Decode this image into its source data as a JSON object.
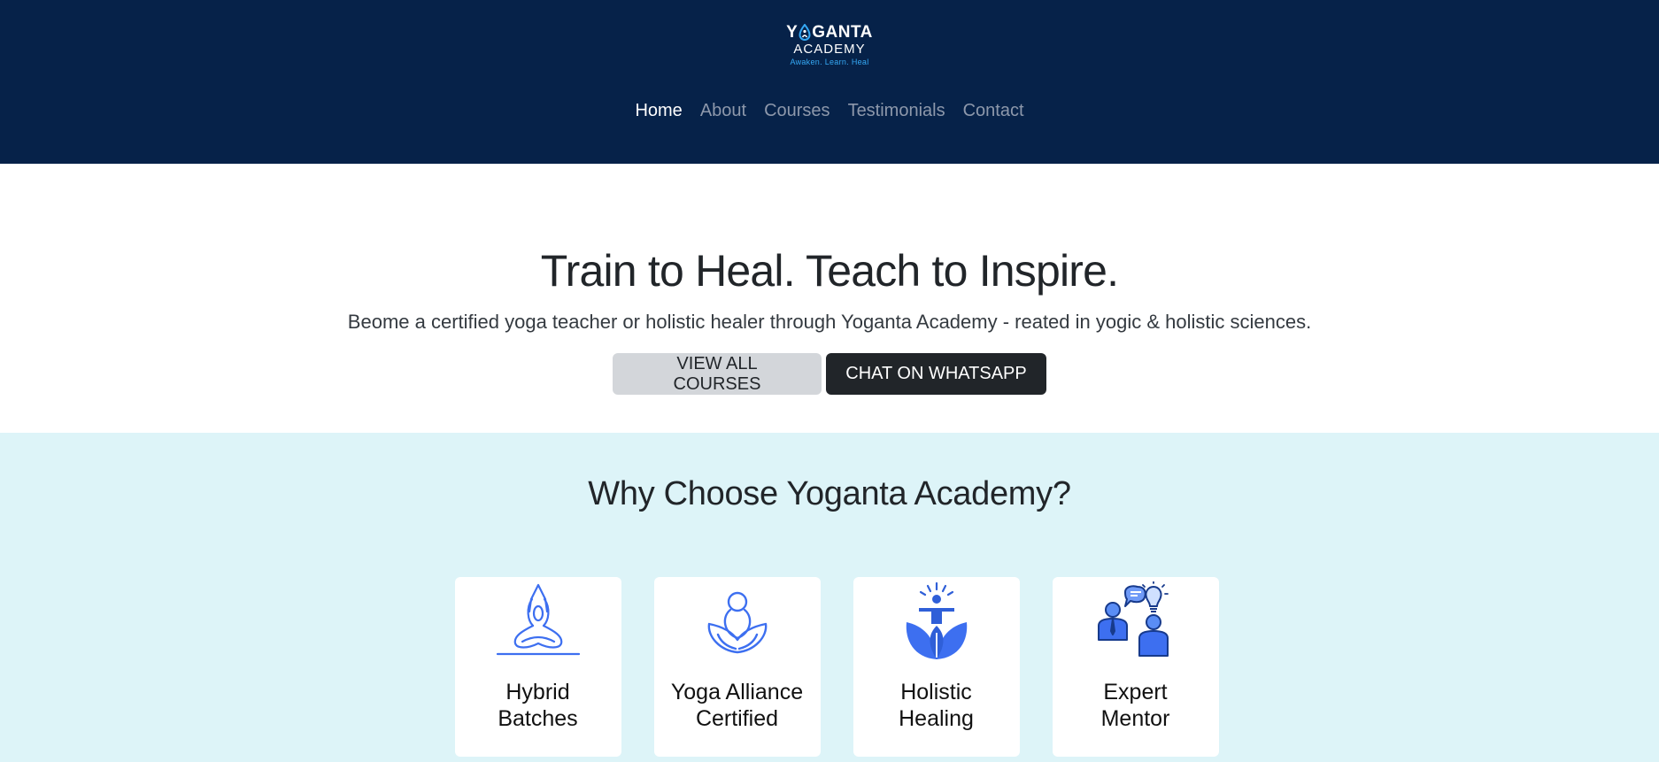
{
  "brand": {
    "name_part1": "Y",
    "name_part2": "GANTA",
    "line2": "ACADEMY",
    "tagline": "Awaken. Learn. Heal"
  },
  "nav": {
    "items": [
      {
        "label": "Home",
        "active": true
      },
      {
        "label": "About",
        "active": false
      },
      {
        "label": "Courses",
        "active": false
      },
      {
        "label": "Testimonials",
        "active": false
      },
      {
        "label": "Contact",
        "active": false
      }
    ]
  },
  "hero": {
    "title": "Train to Heal. Teach to Inspire.",
    "subtitle": "Beome a certified yoga teacher or holistic healer through Yoganta Academy - reated in yogic & holistic sciences.",
    "primary_button": "VIEW ALL COURSES",
    "secondary_button": "CHAT ON WHATSAPP"
  },
  "why": {
    "title": "Why Choose Yoganta Academy?",
    "cards": [
      {
        "line1": "Hybrid",
        "line2": "Batches",
        "icon": "meditating-person-icon"
      },
      {
        "line1": "Yoga Alliance",
        "line2": "Certified",
        "icon": "lotus-meditation-icon"
      },
      {
        "line1": "Holistic",
        "line2": "Healing",
        "icon": "person-on-leaves-icon"
      },
      {
        "line1": "Expert",
        "line2": "Mentor",
        "icon": "mentor-discussion-icon"
      }
    ]
  },
  "colors": {
    "header_bg": "#062249",
    "accent_blue": "#3d6ff0",
    "why_bg": "#ddf4f8",
    "tagline": "#35a9f5"
  }
}
